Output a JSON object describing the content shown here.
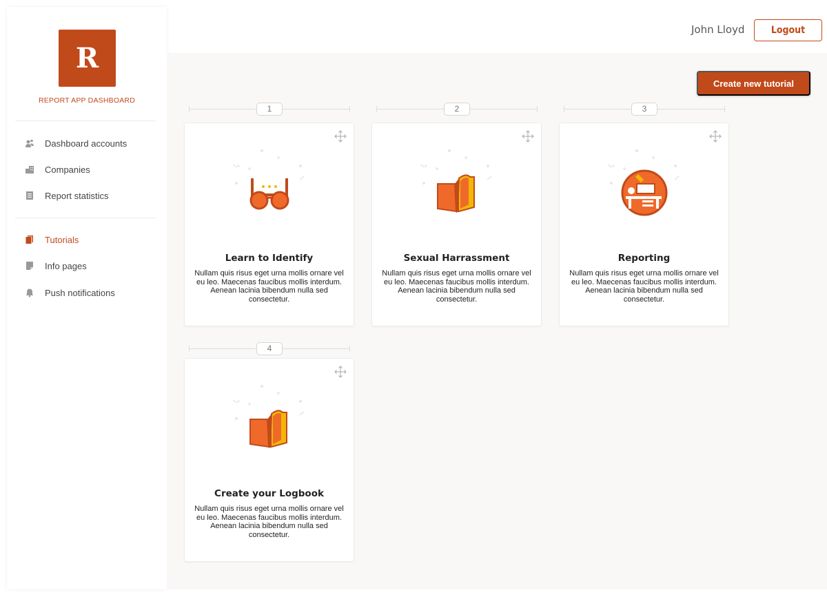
{
  "app": {
    "logo_letter": "R",
    "brand": "REPORT APP DASHBOARD",
    "accent": "#c14a1a"
  },
  "header": {
    "user_name": "John Lloyd",
    "logout_label": "Logout"
  },
  "sidebar": {
    "items": [
      {
        "label": "Dashboard accounts",
        "icon": "users-icon"
      },
      {
        "label": "Companies",
        "icon": "building-icon"
      },
      {
        "label": "Report statistics",
        "icon": "document-icon"
      },
      {
        "label": "Tutorials",
        "icon": "tutorials-icon",
        "active": true
      },
      {
        "label": "Info pages",
        "icon": "page-icon"
      },
      {
        "label": "Push notifications",
        "icon": "bell-icon"
      }
    ]
  },
  "main": {
    "create_label": "Create new tutorial",
    "tutorials": [
      {
        "order": "1",
        "title": "Learn to Identify",
        "icon": "glasses-icon",
        "description": "Nullam quis risus eget urna mollis ornare vel eu leo. Maecenas faucibus mollis interdum. Aenean lacinia bibendum nulla sed consectetur."
      },
      {
        "order": "2",
        "title": "Sexual Harrassment",
        "icon": "book-icon",
        "description": "Nullam quis risus eget urna mollis ornare vel eu leo. Maecenas faucibus mollis interdum. Aenean lacinia bibendum nulla sed consectetur."
      },
      {
        "order": "3",
        "title": "Reporting",
        "icon": "desk-icon",
        "description": "Nullam quis risus eget urna mollis ornare vel eu leo. Maecenas faucibus mollis interdum. Aenean lacinia bibendum nulla sed consectetur."
      },
      {
        "order": "4",
        "title": "Create your Logbook",
        "icon": "book-icon",
        "description": "Nullam quis risus eget urna mollis ornare vel eu leo. Maecenas faucibus mollis interdum. Aenean lacinia bibendum nulla sed consectetur."
      }
    ]
  }
}
